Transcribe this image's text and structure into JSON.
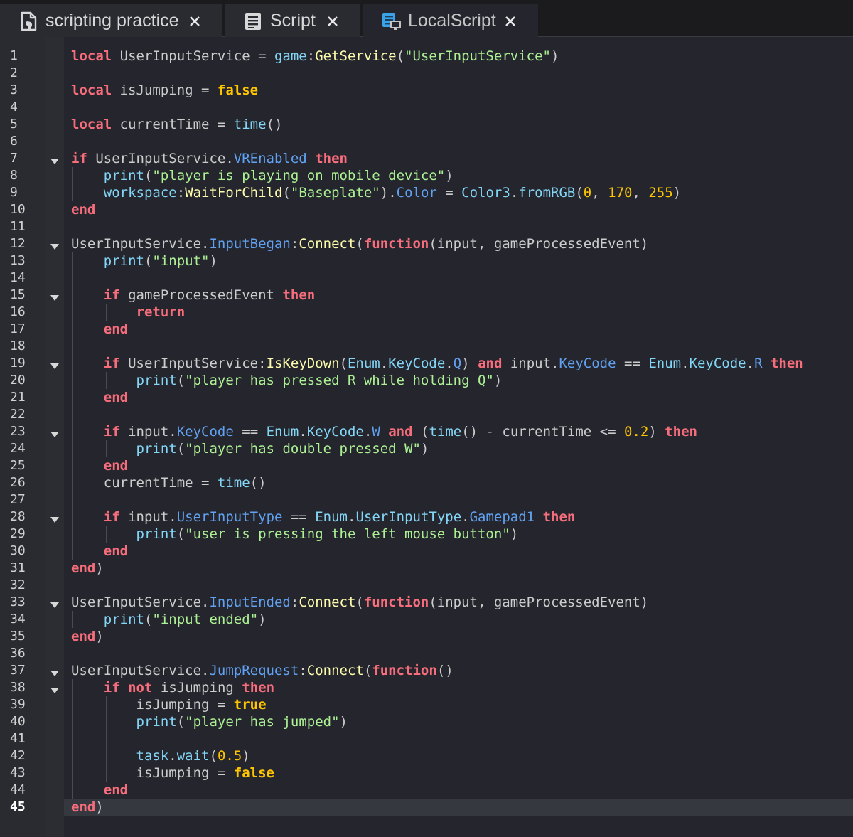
{
  "tabs": [
    {
      "label": "scripting practice",
      "icon": "script-document-icon",
      "active": false
    },
    {
      "label": "Script",
      "icon": "script-icon",
      "active": false
    },
    {
      "label": "LocalScript",
      "icon": "localscript-icon",
      "active": true
    }
  ],
  "editor": {
    "current_line": 45,
    "lines": [
      [
        [
          "kw",
          "local"
        ],
        [
          "text",
          " UserInputService = "
        ],
        [
          "builtin",
          "game"
        ],
        [
          "text",
          ":"
        ],
        [
          "method",
          "GetService"
        ],
        [
          "text",
          "("
        ],
        [
          "str",
          "\"UserInputService\""
        ],
        [
          "text",
          ")"
        ]
      ],
      [],
      [
        [
          "kw",
          "local"
        ],
        [
          "text",
          " isJumping = "
        ],
        [
          "bool",
          "false"
        ]
      ],
      [],
      [
        [
          "kw",
          "local"
        ],
        [
          "text",
          " currentTime = "
        ],
        [
          "builtin",
          "time"
        ],
        [
          "text",
          "()"
        ]
      ],
      [],
      [
        [
          "kw",
          "if"
        ],
        [
          "text",
          " UserInputService."
        ],
        [
          "prop",
          "VREnabled"
        ],
        [
          "text",
          " "
        ],
        [
          "kw",
          "then"
        ]
      ],
      [
        [
          "text",
          "    "
        ],
        [
          "builtin",
          "print"
        ],
        [
          "text",
          "("
        ],
        [
          "str",
          "\"player is playing on mobile device\""
        ],
        [
          "text",
          ")"
        ]
      ],
      [
        [
          "text",
          "    "
        ],
        [
          "builtin",
          "workspace"
        ],
        [
          "text",
          ":"
        ],
        [
          "method",
          "WaitForChild"
        ],
        [
          "text",
          "("
        ],
        [
          "str",
          "\"Baseplate\""
        ],
        [
          "text",
          ")."
        ],
        [
          "prop",
          "Color"
        ],
        [
          "text",
          " = "
        ],
        [
          "builtin",
          "Color3"
        ],
        [
          "text",
          "."
        ],
        [
          "builtin",
          "fromRGB"
        ],
        [
          "text",
          "("
        ],
        [
          "num",
          "0"
        ],
        [
          "text",
          ", "
        ],
        [
          "num",
          "170"
        ],
        [
          "text",
          ", "
        ],
        [
          "num",
          "255"
        ],
        [
          "text",
          ")"
        ]
      ],
      [
        [
          "kw",
          "end"
        ]
      ],
      [],
      [
        [
          "text",
          "UserInputService."
        ],
        [
          "prop",
          "InputBegan"
        ],
        [
          "text",
          ":"
        ],
        [
          "method",
          "Connect"
        ],
        [
          "text",
          "("
        ],
        [
          "kw",
          "function"
        ],
        [
          "text",
          "(input, gameProcessedEvent)"
        ]
      ],
      [
        [
          "text",
          "    "
        ],
        [
          "builtin",
          "print"
        ],
        [
          "text",
          "("
        ],
        [
          "str",
          "\"input\""
        ],
        [
          "text",
          ")"
        ]
      ],
      [],
      [
        [
          "text",
          "    "
        ],
        [
          "kw",
          "if"
        ],
        [
          "text",
          " gameProcessedEvent "
        ],
        [
          "kw",
          "then"
        ]
      ],
      [
        [
          "text",
          "        "
        ],
        [
          "kw",
          "return"
        ]
      ],
      [
        [
          "text",
          "    "
        ],
        [
          "kw",
          "end"
        ]
      ],
      [],
      [
        [
          "text",
          "    "
        ],
        [
          "kw",
          "if"
        ],
        [
          "text",
          " UserInputService:"
        ],
        [
          "method",
          "IsKeyDown"
        ],
        [
          "text",
          "("
        ],
        [
          "builtin",
          "Enum"
        ],
        [
          "text",
          "."
        ],
        [
          "builtin",
          "KeyCode"
        ],
        [
          "text",
          "."
        ],
        [
          "prop",
          "Q"
        ],
        [
          "text",
          ") "
        ],
        [
          "kw",
          "and"
        ],
        [
          "text",
          " input."
        ],
        [
          "prop",
          "KeyCode"
        ],
        [
          "text",
          " == "
        ],
        [
          "builtin",
          "Enum"
        ],
        [
          "text",
          "."
        ],
        [
          "builtin",
          "KeyCode"
        ],
        [
          "text",
          "."
        ],
        [
          "prop",
          "R"
        ],
        [
          "text",
          " "
        ],
        [
          "kw",
          "then"
        ]
      ],
      [
        [
          "text",
          "        "
        ],
        [
          "builtin",
          "print"
        ],
        [
          "text",
          "("
        ],
        [
          "str",
          "\"player has pressed R while holding Q\""
        ],
        [
          "text",
          ")"
        ]
      ],
      [
        [
          "text",
          "    "
        ],
        [
          "kw",
          "end"
        ]
      ],
      [],
      [
        [
          "text",
          "    "
        ],
        [
          "kw",
          "if"
        ],
        [
          "text",
          " input."
        ],
        [
          "prop",
          "KeyCode"
        ],
        [
          "text",
          " == "
        ],
        [
          "builtin",
          "Enum"
        ],
        [
          "text",
          "."
        ],
        [
          "builtin",
          "KeyCode"
        ],
        [
          "text",
          "."
        ],
        [
          "prop",
          "W"
        ],
        [
          "text",
          " "
        ],
        [
          "kw",
          "and"
        ],
        [
          "text",
          " ("
        ],
        [
          "builtin",
          "time"
        ],
        [
          "text",
          "() - currentTime <= "
        ],
        [
          "num",
          "0.2"
        ],
        [
          "text",
          ") "
        ],
        [
          "kw",
          "then"
        ]
      ],
      [
        [
          "text",
          "        "
        ],
        [
          "builtin",
          "print"
        ],
        [
          "text",
          "("
        ],
        [
          "str",
          "\"player has double pressed W\""
        ],
        [
          "text",
          ")"
        ]
      ],
      [
        [
          "text",
          "    "
        ],
        [
          "kw",
          "end"
        ]
      ],
      [
        [
          "text",
          "    currentTime = "
        ],
        [
          "builtin",
          "time"
        ],
        [
          "text",
          "()"
        ]
      ],
      [],
      [
        [
          "text",
          "    "
        ],
        [
          "kw",
          "if"
        ],
        [
          "text",
          " input."
        ],
        [
          "prop",
          "UserInputType"
        ],
        [
          "text",
          " == "
        ],
        [
          "builtin",
          "Enum"
        ],
        [
          "text",
          "."
        ],
        [
          "builtin",
          "UserInputType"
        ],
        [
          "text",
          "."
        ],
        [
          "prop",
          "Gamepad1"
        ],
        [
          "text",
          " "
        ],
        [
          "kw",
          "then"
        ]
      ],
      [
        [
          "text",
          "        "
        ],
        [
          "builtin",
          "print"
        ],
        [
          "text",
          "("
        ],
        [
          "str",
          "\"user is pressing the left mouse button\""
        ],
        [
          "text",
          ")"
        ]
      ],
      [
        [
          "text",
          "    "
        ],
        [
          "kw",
          "end"
        ]
      ],
      [
        [
          "kw",
          "end"
        ],
        [
          "text",
          ")"
        ]
      ],
      [],
      [
        [
          "text",
          "UserInputService."
        ],
        [
          "prop",
          "InputEnded"
        ],
        [
          "text",
          ":"
        ],
        [
          "method",
          "Connect"
        ],
        [
          "text",
          "("
        ],
        [
          "kw",
          "function"
        ],
        [
          "text",
          "(input, gameProcessedEvent)"
        ]
      ],
      [
        [
          "text",
          "    "
        ],
        [
          "builtin",
          "print"
        ],
        [
          "text",
          "("
        ],
        [
          "str",
          "\"input ended\""
        ],
        [
          "text",
          ")"
        ]
      ],
      [
        [
          "kw",
          "end"
        ],
        [
          "text",
          ")"
        ]
      ],
      [],
      [
        [
          "text",
          "UserInputService."
        ],
        [
          "prop",
          "JumpRequest"
        ],
        [
          "text",
          ":"
        ],
        [
          "method",
          "Connect"
        ],
        [
          "text",
          "("
        ],
        [
          "kw",
          "function"
        ],
        [
          "text",
          "()"
        ]
      ],
      [
        [
          "text",
          "    "
        ],
        [
          "kw",
          "if"
        ],
        [
          "text",
          " "
        ],
        [
          "kw",
          "not"
        ],
        [
          "text",
          " isJumping "
        ],
        [
          "kw",
          "then"
        ]
      ],
      [
        [
          "text",
          "        isJumping = "
        ],
        [
          "bool",
          "true"
        ]
      ],
      [
        [
          "text",
          "        "
        ],
        [
          "builtin",
          "print"
        ],
        [
          "text",
          "("
        ],
        [
          "str",
          "\"player has jumped\""
        ],
        [
          "text",
          ")"
        ]
      ],
      [],
      [
        [
          "text",
          "        "
        ],
        [
          "builtin",
          "task"
        ],
        [
          "text",
          "."
        ],
        [
          "builtin",
          "wait"
        ],
        [
          "text",
          "("
        ],
        [
          "num",
          "0.5"
        ],
        [
          "text",
          ")"
        ]
      ],
      [
        [
          "text",
          "        isJumping = "
        ],
        [
          "bool",
          "false"
        ]
      ],
      [
        [
          "text",
          "    "
        ],
        [
          "kw",
          "end"
        ]
      ],
      [
        [
          "kw",
          "end"
        ],
        [
          "text",
          ")"
        ]
      ]
    ],
    "fold_lines": [
      7,
      12,
      15,
      19,
      23,
      28,
      33,
      37,
      38
    ]
  }
}
